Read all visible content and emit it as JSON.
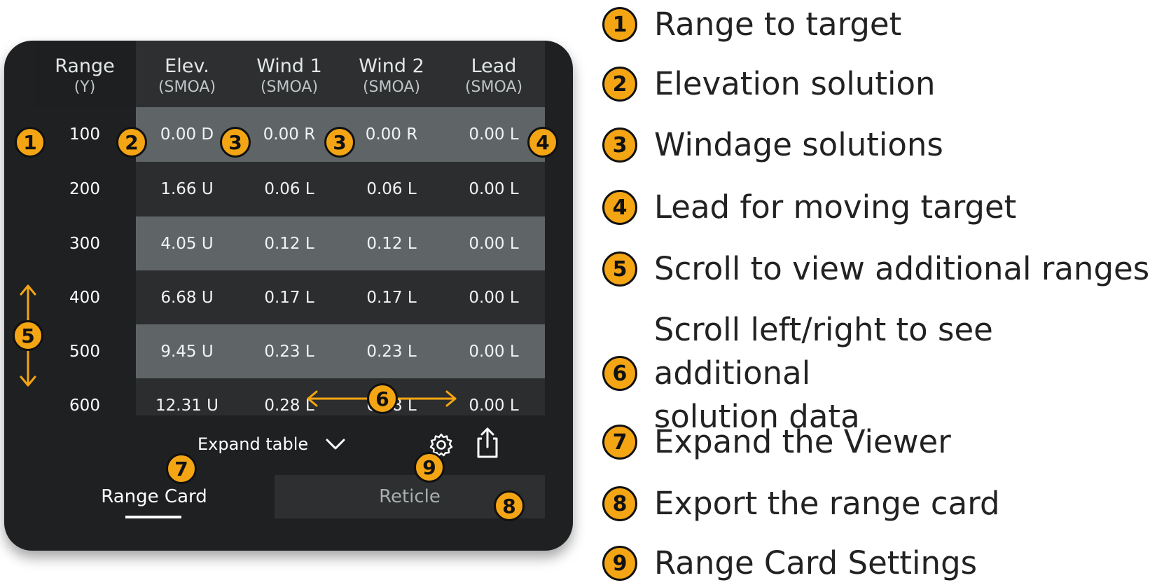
{
  "table": {
    "columns": [
      {
        "name": "Range",
        "unit": "(Y)"
      },
      {
        "name": "Elev.",
        "unit": "(SMOA)"
      },
      {
        "name": "Wind 1",
        "unit": "(SMOA)"
      },
      {
        "name": "Wind 2",
        "unit": "(SMOA)"
      },
      {
        "name": "Lead",
        "unit": "(SMOA)"
      }
    ],
    "rows": [
      [
        "100",
        "0.00 D",
        "0.00 R",
        "0.00 R",
        "0.00 L"
      ],
      [
        "200",
        "1.66 U",
        "0.06 L",
        "0.06 L",
        "0.00 L"
      ],
      [
        "300",
        "4.05 U",
        "0.12 L",
        "0.12 L",
        "0.00 L"
      ],
      [
        "400",
        "6.68 U",
        "0.17 L",
        "0.17 L",
        "0.00 L"
      ],
      [
        "500",
        "9.45 U",
        "0.23 L",
        "0.23 L",
        "0.00 L"
      ],
      [
        "600",
        "12.31 U",
        "0.28 L",
        "0.28 L",
        "0.00 L"
      ]
    ]
  },
  "footer": {
    "expand_label": "Expand table",
    "chevron_icon": "chevron-down-icon",
    "settings_icon": "gear-icon",
    "export_icon": "share-icon"
  },
  "tabs": {
    "range_card": "Range Card",
    "reticle": "Reticle"
  },
  "callouts": {
    "range": "1",
    "elevation": "2",
    "wind1": "3",
    "wind2": "3",
    "lead": "4",
    "scroll_vertical": "5",
    "scroll_horizontal": "6",
    "expand": "7",
    "export": "8",
    "settings": "9"
  },
  "legend": [
    {
      "number": "1",
      "text": "Range to target"
    },
    {
      "number": "2",
      "text": "Elevation solution"
    },
    {
      "number": "3",
      "text": "Windage solutions"
    },
    {
      "number": "4",
      "text": "Lead for moving target"
    },
    {
      "number": "5",
      "text": "Scroll to view additional ranges"
    },
    {
      "number": "6",
      "text": "Scroll left/right to see additional",
      "text2": "solution data"
    },
    {
      "number": "7",
      "text": "Expand the Viewer"
    },
    {
      "number": "8",
      "text": "Export the range card"
    },
    {
      "number": "9",
      "text": "Range Card Settings"
    }
  ],
  "colors": {
    "callout": "#f4a514",
    "device": "#1f2021",
    "row_light": "#5f6566",
    "row_dark": "#2b2d2e"
  }
}
